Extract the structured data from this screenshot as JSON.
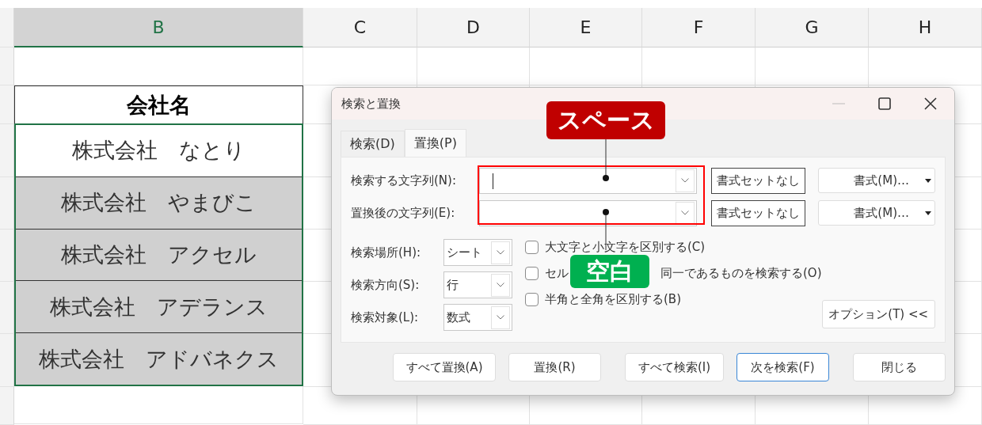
{
  "sheet": {
    "columns": [
      {
        "label": "B",
        "selected": true
      },
      {
        "label": "C",
        "selected": false
      },
      {
        "label": "D",
        "selected": false
      },
      {
        "label": "E",
        "selected": false
      },
      {
        "label": "F",
        "selected": false
      },
      {
        "label": "G",
        "selected": false
      },
      {
        "label": "H",
        "selected": false
      }
    ],
    "cells": [
      {
        "kind": "header",
        "text": "会社名",
        "shaded": false
      },
      {
        "kind": "data",
        "text": "株式会社　なとり",
        "shaded": false
      },
      {
        "kind": "data",
        "text": "株式会社　やまびこ",
        "shaded": true
      },
      {
        "kind": "data",
        "text": "株式会社　アクセル",
        "shaded": true
      },
      {
        "kind": "data",
        "text": "株式会社　アデランス",
        "shaded": true
      },
      {
        "kind": "data",
        "text": "株式会社　アドバネクス",
        "shaded": true
      }
    ]
  },
  "dialog": {
    "title": "検索と置換",
    "tabs": [
      {
        "label": "検索(D)",
        "selected": false
      },
      {
        "label": "置換(P)",
        "selected": true
      }
    ],
    "fields": [
      {
        "label": "検索する文字列(N):",
        "focused": true,
        "format_status": "書式セットなし",
        "format_button": "書式(M)…"
      },
      {
        "label": "置換後の文字列(E):",
        "focused": false,
        "format_status": "書式セットなし",
        "format_button": "書式(M)…"
      }
    ],
    "selects": [
      {
        "label": "検索場所(H):",
        "value": "シート"
      },
      {
        "label": "検索方向(S):",
        "value": "行"
      },
      {
        "label": "検索対象(L):",
        "value": "数式"
      }
    ],
    "checkboxes": [
      {
        "label": "大文字と小文字を区別する(C)",
        "checked": false
      },
      {
        "label": "セル",
        "label_tail": "同一であるものを検索する(O)",
        "checked": false
      },
      {
        "label": "半角と全角を区別する(B)",
        "checked": false
      }
    ],
    "options_button": "オプション(T) <<",
    "buttons": [
      {
        "label": "すべて置換(A)",
        "default": false
      },
      {
        "label": "置換(R)",
        "default": false
      },
      {
        "label": "すべて検索(I)",
        "default": false
      },
      {
        "label": "次を検索(F)",
        "default": true
      },
      {
        "label": "閉じる",
        "default": false
      }
    ]
  },
  "annotations": [
    {
      "kind": "top",
      "text": "スペース",
      "color": "#c00000"
    },
    {
      "kind": "bottom",
      "text": "空白",
      "color": "#00b050"
    }
  ]
}
